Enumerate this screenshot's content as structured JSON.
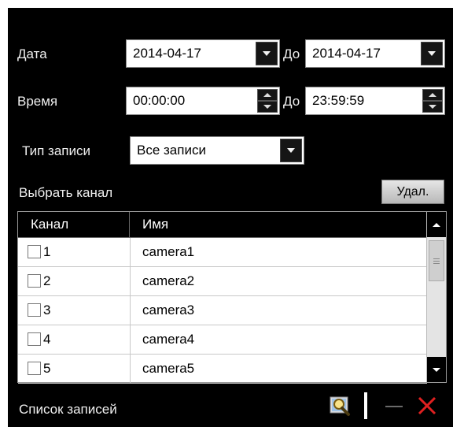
{
  "filters": {
    "date_label": "Дата",
    "date_from": "2014-04-17",
    "to_label": "До",
    "date_to": "2014-04-17",
    "time_label": "Время",
    "time_from": "00:00:00",
    "time_to": "23:59:59",
    "record_type_label": "Тип записи",
    "record_type_value": "Все записи"
  },
  "channels": {
    "select_label": "Выбрать канал",
    "delete_button": "Удал.",
    "col_channel": "Канал",
    "col_name": "Имя",
    "rows": [
      {
        "channel": "1",
        "name": "camera1",
        "checked": false
      },
      {
        "channel": "2",
        "name": "camera2",
        "checked": false
      },
      {
        "channel": "3",
        "name": "camera3",
        "checked": false
      },
      {
        "channel": "4",
        "name": "camera4",
        "checked": false
      },
      {
        "channel": "5",
        "name": "camera5",
        "checked": false
      }
    ]
  },
  "records": {
    "list_label": "Список записей"
  },
  "icons": {
    "search": "search-icon",
    "divider": "separator-icon",
    "minus": "minus-icon",
    "close": "close-icon"
  },
  "colors": {
    "panel_bg": "#000000",
    "close_red": "#e02020",
    "minus_gray": "#6a6a6a"
  }
}
